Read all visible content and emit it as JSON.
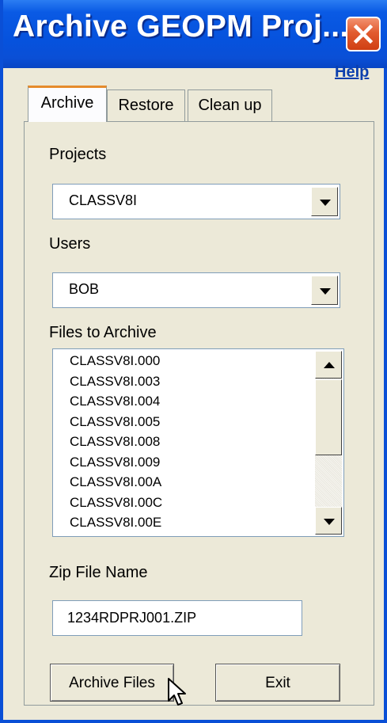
{
  "window": {
    "title": "Archive GEOPM Proj...",
    "help_label": "Help",
    "colors": {
      "titlebar": "#0a4fd6",
      "close": "#e25c2f",
      "face": "#ece9d8"
    }
  },
  "tabs": [
    {
      "label": "Archive",
      "active": true
    },
    {
      "label": "Restore",
      "active": false
    },
    {
      "label": "Clean up",
      "active": false
    }
  ],
  "projects": {
    "label": "Projects",
    "value": "CLASSV8I"
  },
  "users": {
    "label": "Users",
    "value": "BOB"
  },
  "files": {
    "label": "Files to Archive",
    "items": [
      "CLASSV8I.000",
      "CLASSV8I.003",
      "CLASSV8I.004",
      "CLASSV8I.005",
      "CLASSV8I.008",
      "CLASSV8I.009",
      "CLASSV8I.00A",
      "CLASSV8I.00C",
      "CLASSV8I.00E"
    ]
  },
  "zip": {
    "label": "Zip File Name",
    "value": "1234RDPRJ001.ZIP"
  },
  "buttons": {
    "archive": "Archive Files",
    "exit": "Exit"
  },
  "icons": {
    "close": "close-x-icon",
    "dropdown": "chevron-down-icon",
    "cursor": "mouse-pointer-icon"
  }
}
